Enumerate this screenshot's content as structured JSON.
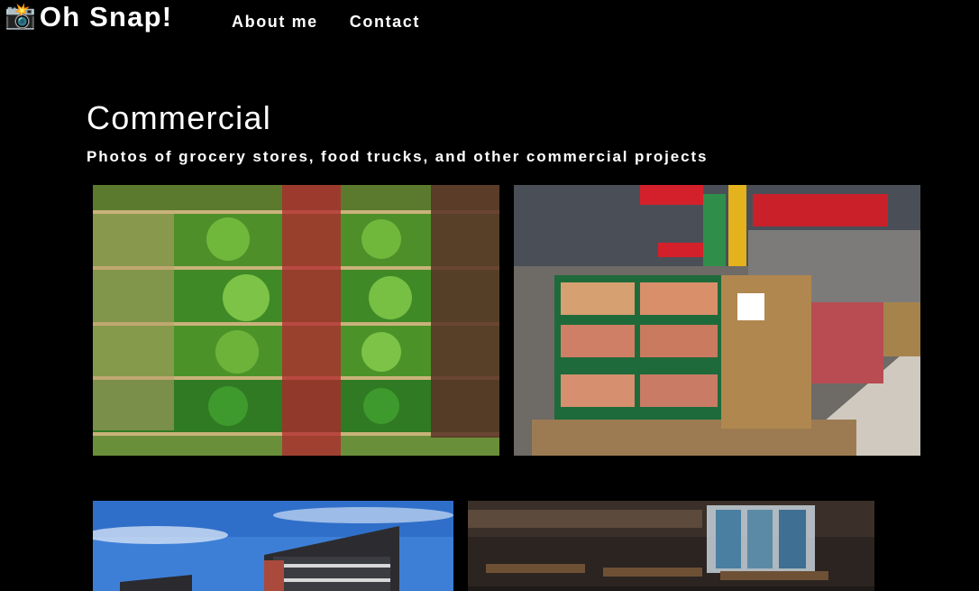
{
  "header": {
    "brand_icon": "camera-flash-icon",
    "brand_emoji": "📸",
    "brand_name": "Oh Snap!",
    "nav": [
      {
        "label": "About me"
      },
      {
        "label": "Contact"
      }
    ]
  },
  "main": {
    "title": "Commercial",
    "subtitle": "Photos of grocery stores, food trucks, and other commercial projects"
  },
  "gallery": [
    {
      "subject": "produce-shelves"
    },
    {
      "subject": "supermarket-fruit-aisle"
    },
    {
      "subject": "modern-building"
    },
    {
      "subject": "restaurant-interior"
    }
  ],
  "colors": {
    "background": "#000000",
    "text": "#ffffff"
  }
}
